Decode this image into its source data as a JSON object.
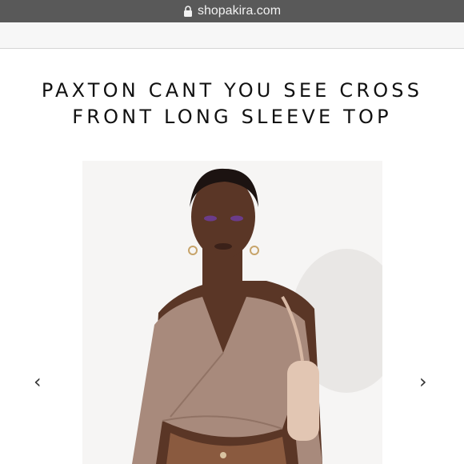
{
  "browser": {
    "url": "shopakira.com",
    "lock_icon": "lock-icon"
  },
  "product": {
    "title_line1": "PAXTON CANT YOU SEE CROSS",
    "title_line2": "FRONT LONG SLEEVE TOP"
  },
  "gallery": {
    "prev_label": "‹",
    "next_label": "›",
    "image_alt": "Model wearing a taupe ribbed cross-front long sleeve crop top with tan shoulder bag and brown leather pants"
  },
  "colors": {
    "browser_bar": "#595959",
    "top_color": "#a88a7c",
    "bag_color": "#e2c6b3",
    "pants_color": "#8a5a3f",
    "skin_color": "#5a3626"
  }
}
